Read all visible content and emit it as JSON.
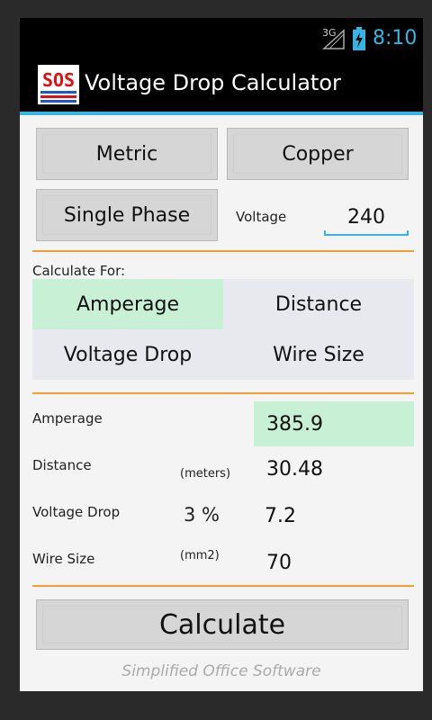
{
  "status_bar": {
    "network": "3G",
    "time": "8:10"
  },
  "app": {
    "logo_text": "SOS",
    "title": "Voltage Drop Calculator"
  },
  "settings": {
    "unit_button": "Metric",
    "material_button": "Copper",
    "phase_button": "Single Phase",
    "voltage_label": "Voltage",
    "voltage_value": "240"
  },
  "calculate_for": {
    "label": "Calculate For:",
    "options": [
      "Amperage",
      "Distance",
      "Voltage Drop",
      "Wire Size"
    ],
    "selected": "Amperage"
  },
  "results": {
    "amperage": {
      "label": "Amperage",
      "value": "385.9"
    },
    "distance": {
      "label": "Distance",
      "unit": "(meters)",
      "value": "30.48"
    },
    "voltage_drop": {
      "label": "Voltage Drop",
      "percent": "3 %",
      "value": "7.2"
    },
    "wire_size": {
      "label": "Wire Size",
      "unit": "(mm2)",
      "value": "70"
    }
  },
  "calculate_button": "Calculate",
  "footer": "Simplified Office Software",
  "colors": {
    "accent": "#33b5e5",
    "divider": "#f0a030",
    "selected": "#c8f0d4"
  }
}
